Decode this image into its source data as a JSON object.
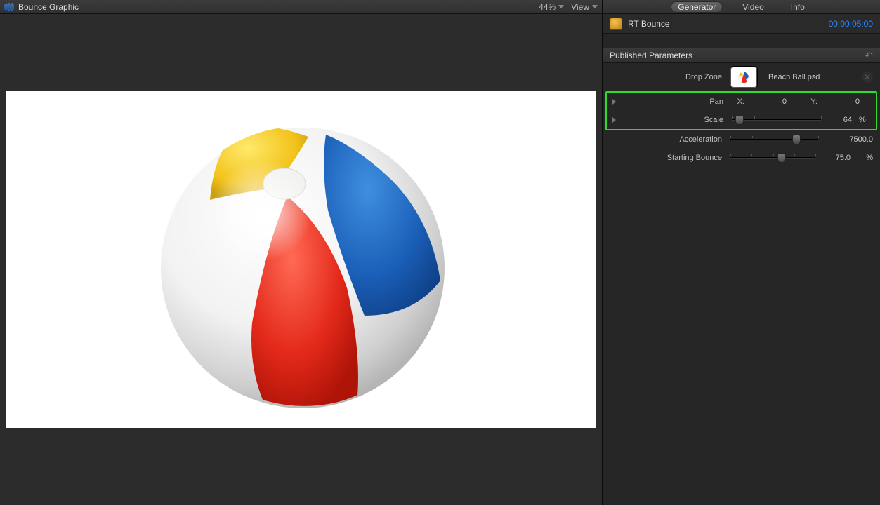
{
  "viewer": {
    "title": "Bounce Graphic",
    "zoom": "44%",
    "viewMenu": "View"
  },
  "inspector": {
    "tabs": {
      "generator": "Generator",
      "video": "Video",
      "info": "Info",
      "active": "generator"
    },
    "clipName": "RT Bounce",
    "timecode": "00:00:05:00",
    "sectionTitle": "Published Parameters",
    "dropZone": {
      "label": "Drop Zone",
      "fileName": "Beach Ball.psd"
    },
    "pan": {
      "label": "Pan",
      "xLabel": "X:",
      "xValue": "0",
      "yLabel": "Y:",
      "yValue": "0"
    },
    "scale": {
      "label": "Scale",
      "value": "64",
      "suffix": "%",
      "sliderPct": 9
    },
    "acceleration": {
      "label": "Acceleration",
      "value": "7500.0",
      "sliderPct": 75
    },
    "startingBounce": {
      "label": "Starting Bounce",
      "value": "75.0",
      "suffix": "%",
      "sliderPct": 60
    }
  }
}
